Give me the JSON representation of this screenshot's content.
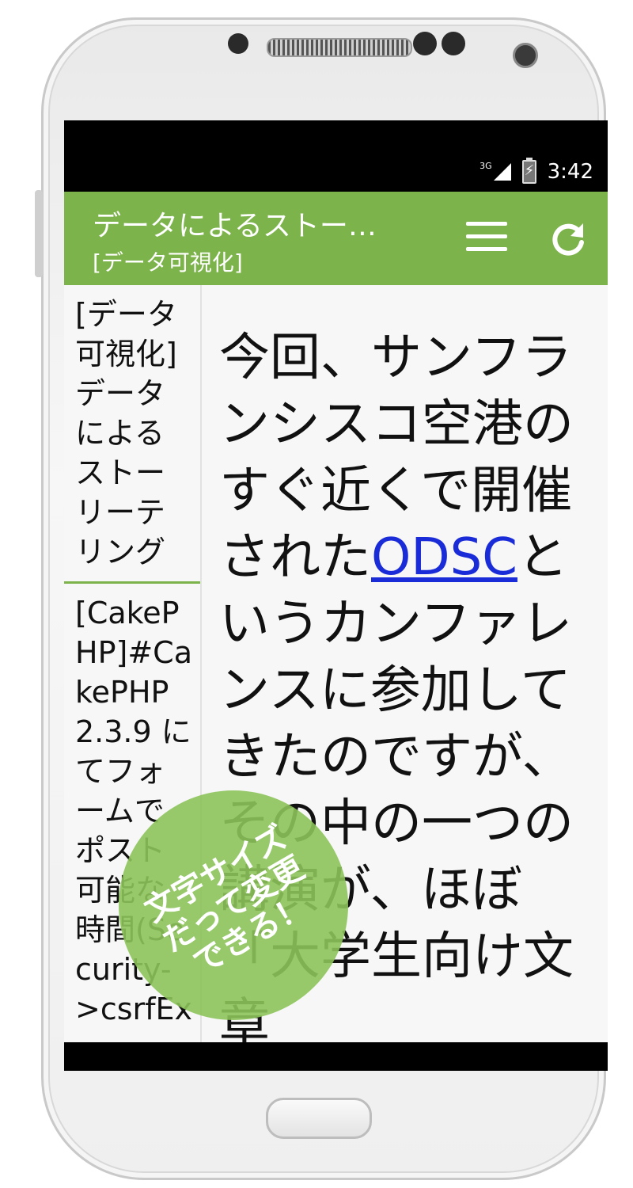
{
  "status_bar": {
    "network": "3G",
    "time": "3:42"
  },
  "action_bar": {
    "title": "データによるストー…",
    "subtitle": "[データ可視化]",
    "menu_icon": "menu-icon",
    "refresh_icon": "refresh-icon"
  },
  "sidebar": {
    "items": [
      {
        "label": "[データ可視化]データによるストーリーテリング"
      },
      {
        "label": "[CakePHP]#CakePHP 2.3.9 にてフォームでポスト可能な時間(Security->csrfEx"
      }
    ]
  },
  "article": {
    "text_before": "今回、サンフランシスコ空港のすぐ近くで開催された",
    "link": "ODSC",
    "text_after": "というカンファレンスに参加してきたのですが、その中の一つの講演が、ほぼ「大学生向け文章"
  },
  "badge": {
    "line1": "文字サイズ",
    "line2": "だって変更",
    "line3": "できる！"
  },
  "colors": {
    "accent": "#7cb34a",
    "link": "#1a2bd8"
  }
}
